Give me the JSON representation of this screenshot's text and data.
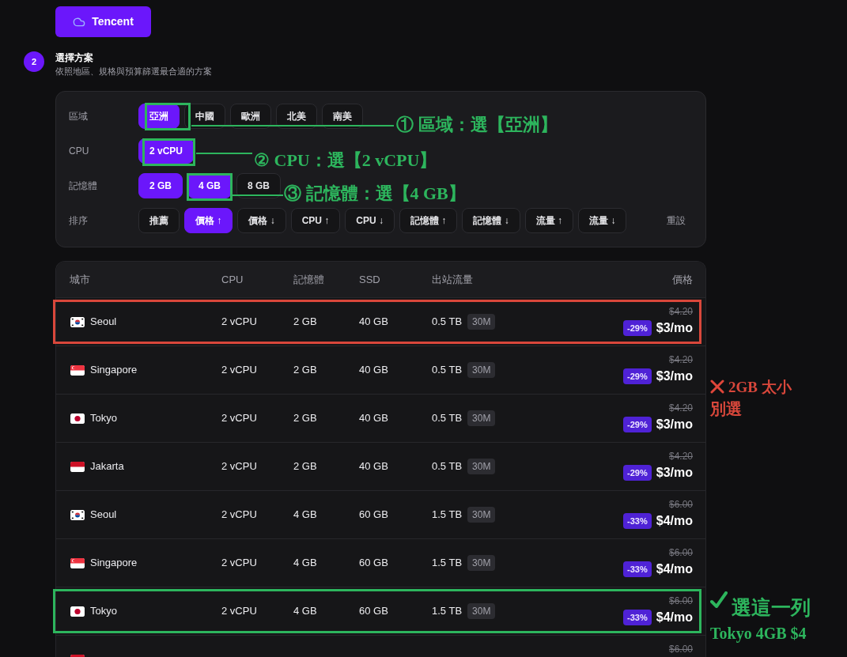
{
  "provider_button": {
    "label": "Tencent"
  },
  "step": {
    "number": "2",
    "title": "選擇方案",
    "subtitle": "依照地區、規格與預算篩選最合適的方案"
  },
  "filters": [
    {
      "label": "區域",
      "chips": [
        {
          "label": "亞洲",
          "selected": true,
          "boxed": true
        },
        {
          "label": "中國",
          "selected": false,
          "boxed": false
        },
        {
          "label": "歐洲",
          "selected": false,
          "boxed": false
        },
        {
          "label": "北美",
          "selected": false,
          "boxed": false
        },
        {
          "label": "南美",
          "selected": false,
          "boxed": false
        }
      ]
    },
    {
      "label": "CPU",
      "chips": [
        {
          "label": "2 vCPU",
          "selected": true,
          "boxed": true
        }
      ]
    },
    {
      "label": "記憶體",
      "chips": [
        {
          "label": "2 GB",
          "selected": true,
          "boxed": false
        },
        {
          "label": "4 GB",
          "selected": true,
          "boxed": true
        },
        {
          "label": "8 GB",
          "selected": false,
          "boxed": false
        }
      ]
    },
    {
      "label": "排序",
      "chips": [
        {
          "label": "推薦",
          "selected": false,
          "boxed": false
        },
        {
          "label": "價格 ↑",
          "selected": true,
          "boxed": false
        },
        {
          "label": "價格 ↓",
          "selected": false,
          "boxed": false
        },
        {
          "label": "CPU ↑",
          "selected": false,
          "boxed": false
        },
        {
          "label": "CPU ↓",
          "selected": false,
          "boxed": false
        },
        {
          "label": "記憶體 ↑",
          "selected": false,
          "boxed": false
        },
        {
          "label": "記憶體 ↓",
          "selected": false,
          "boxed": false
        },
        {
          "label": "流量 ↑",
          "selected": false,
          "boxed": false
        },
        {
          "label": "流量 ↓",
          "selected": false,
          "boxed": false
        }
      ]
    }
  ],
  "reset_button": {
    "label": "重設"
  },
  "table": {
    "columns": [
      "城市",
      "CPU",
      "記憶體",
      "SSD",
      "出站流量",
      "價格"
    ],
    "rows": [
      {
        "flag": {
          "kind": "korea"
        },
        "city": "Seoul",
        "cpu": "2 vCPU",
        "memory": "2 GB",
        "ssd": "40 GB",
        "traffic": "0.5 TB",
        "bandwidth": "30M",
        "old_price": "$4.20",
        "discount": "-29%",
        "price": "$3/mo",
        "outline": {
          "color": "#d9473b"
        }
      },
      {
        "flag": {
          "kind": "singapore"
        },
        "city": "Singapore",
        "cpu": "2 vCPU",
        "memory": "2 GB",
        "ssd": "40 GB",
        "traffic": "0.5 TB",
        "bandwidth": "30M",
        "old_price": "$4.20",
        "discount": "-29%",
        "price": "$3/mo"
      },
      {
        "flag": {
          "kind": "japan"
        },
        "city": "Tokyo",
        "cpu": "2 vCPU",
        "memory": "2 GB",
        "ssd": "40 GB",
        "traffic": "0.5 TB",
        "bandwidth": "30M",
        "old_price": "$4.20",
        "discount": "-29%",
        "price": "$3/mo"
      },
      {
        "flag": {
          "kind": "indonesia"
        },
        "city": "Jakarta",
        "cpu": "2 vCPU",
        "memory": "2 GB",
        "ssd": "40 GB",
        "traffic": "0.5 TB",
        "bandwidth": "30M",
        "old_price": "$4.20",
        "discount": "-29%",
        "price": "$3/mo"
      },
      {
        "flag": {
          "kind": "korea"
        },
        "city": "Seoul",
        "cpu": "2 vCPU",
        "memory": "4 GB",
        "ssd": "60 GB",
        "traffic": "1.5 TB",
        "bandwidth": "30M",
        "old_price": "$6.00",
        "discount": "-33%",
        "price": "$4/mo"
      },
      {
        "flag": {
          "kind": "singapore"
        },
        "city": "Singapore",
        "cpu": "2 vCPU",
        "memory": "4 GB",
        "ssd": "60 GB",
        "traffic": "1.5 TB",
        "bandwidth": "30M",
        "old_price": "$6.00",
        "discount": "-33%",
        "price": "$4/mo"
      },
      {
        "flag": {
          "kind": "japan"
        },
        "city": "Tokyo",
        "cpu": "2 vCPU",
        "memory": "4 GB",
        "ssd": "60 GB",
        "traffic": "1.5 TB",
        "bandwidth": "30M",
        "old_price": "$6.00",
        "discount": "-33%",
        "price": "$4/mo",
        "outline": {
          "color": "#2db55d"
        }
      },
      {
        "flag": {
          "kind": "indonesia"
        },
        "old_price": "$6.00"
      }
    ]
  },
  "annotations": [
    {
      "kind": "callout",
      "text": "① 區域：選【亞洲】"
    },
    {
      "kind": "callout",
      "text": "② CPU：選【2 vCPU】"
    },
    {
      "kind": "callout",
      "text": "③ 記憶體：選【4 GB】"
    },
    {
      "kind": "reject",
      "lines": [
        "2GB 太小",
        "別選"
      ]
    },
    {
      "kind": "pick",
      "lines": [
        "選這一列",
        "Tokyo 4GB $4"
      ]
    }
  ]
}
